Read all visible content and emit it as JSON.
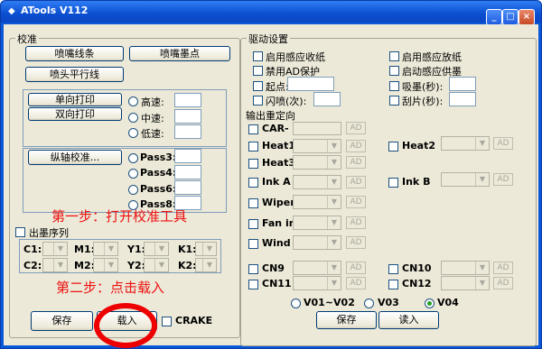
{
  "window": {
    "title": "ATools V112",
    "app_icon": "diamond-icon",
    "minimize_icon": "minimize-icon",
    "maximize_icon": "maximize-icon",
    "close_icon": "close-icon"
  },
  "calibration": {
    "legend": "校准",
    "nozzle_line": "喷嘴线条",
    "nozzle_dot": "喷嘴墨点",
    "head_parallel": "喷头平行线",
    "one_way": "单向打印",
    "two_way": "双向打印",
    "speed_high": "高速:",
    "speed_mid": "中速:",
    "speed_low": "低速:",
    "vertical": "纵轴校准...",
    "pass3": "Pass3:",
    "pass4": "Pass4:",
    "pass6": "Pass6:",
    "pass8": "Pass8:",
    "ink_order": "出墨序列",
    "c1": "C1:",
    "m1": "M1:",
    "y1": "Y1:",
    "k1": "K1:",
    "c2": "C2:",
    "m2": "M2:",
    "y2": "Y2:",
    "k2": "K2:",
    "save": "保存",
    "load": "载入",
    "crake": "CRAKE"
  },
  "drive": {
    "legend": "驱动设置",
    "enable_take_up": "启用感应收纸",
    "enable_feed": "启用感应放纸",
    "disable_ad": "禁用AD保护",
    "ink_supply": "启动感应供墨",
    "start_point": "起点:",
    "suction": "吸墨(秒):",
    "flash": "闪喷(次):",
    "scrape": "刮片(秒):"
  },
  "output": {
    "legend": "输出重定向",
    "ad": "AD",
    "rows": {
      "car": "CAR-",
      "heat1": "Heat1",
      "heat2": "Heat2",
      "heat3": "Heat3",
      "inka": "Ink A",
      "inkb": "Ink B",
      "wiper": "Wiper",
      "fanin": "Fan in",
      "wind": "Wind",
      "cn9": "CN9",
      "cn10": "CN10",
      "cn11": "CN11",
      "cn12": "CN12"
    },
    "v01_v02": "V01~V02",
    "v03": "V03",
    "v04": "V04",
    "selected_version": "V04",
    "save": "保存",
    "read": "读入"
  },
  "annotations": {
    "step1": "第一步：打开校准工具",
    "step2": "第二步：点击载入",
    "color": "#e11111"
  }
}
